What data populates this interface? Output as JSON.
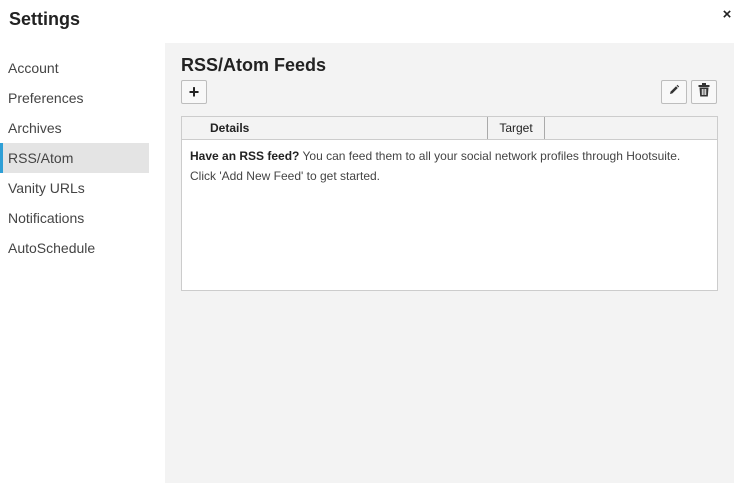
{
  "dialog": {
    "title": "Settings",
    "close_label": "×"
  },
  "sidebar": {
    "items": [
      {
        "label": "Account"
      },
      {
        "label": "Preferences"
      },
      {
        "label": "Archives"
      },
      {
        "label": "RSS/Atom",
        "active": true
      },
      {
        "label": "Vanity URLs"
      },
      {
        "label": "Notifications"
      },
      {
        "label": "AutoSchedule"
      }
    ]
  },
  "main": {
    "title": "RSS/Atom Feeds",
    "add_label": "+",
    "icons": {
      "edit": "pencil-icon",
      "delete": "trash-icon"
    },
    "table": {
      "columns": [
        "Details",
        "Target"
      ],
      "empty_bold": "Have an RSS feed?",
      "empty_text": " You can feed them to all your social network profiles through Hootsuite.",
      "empty_hint": "Click 'Add New Feed' to get started."
    }
  },
  "colors": {
    "accent": "#2e9fd6",
    "panel_bg": "#f3f3f3"
  }
}
